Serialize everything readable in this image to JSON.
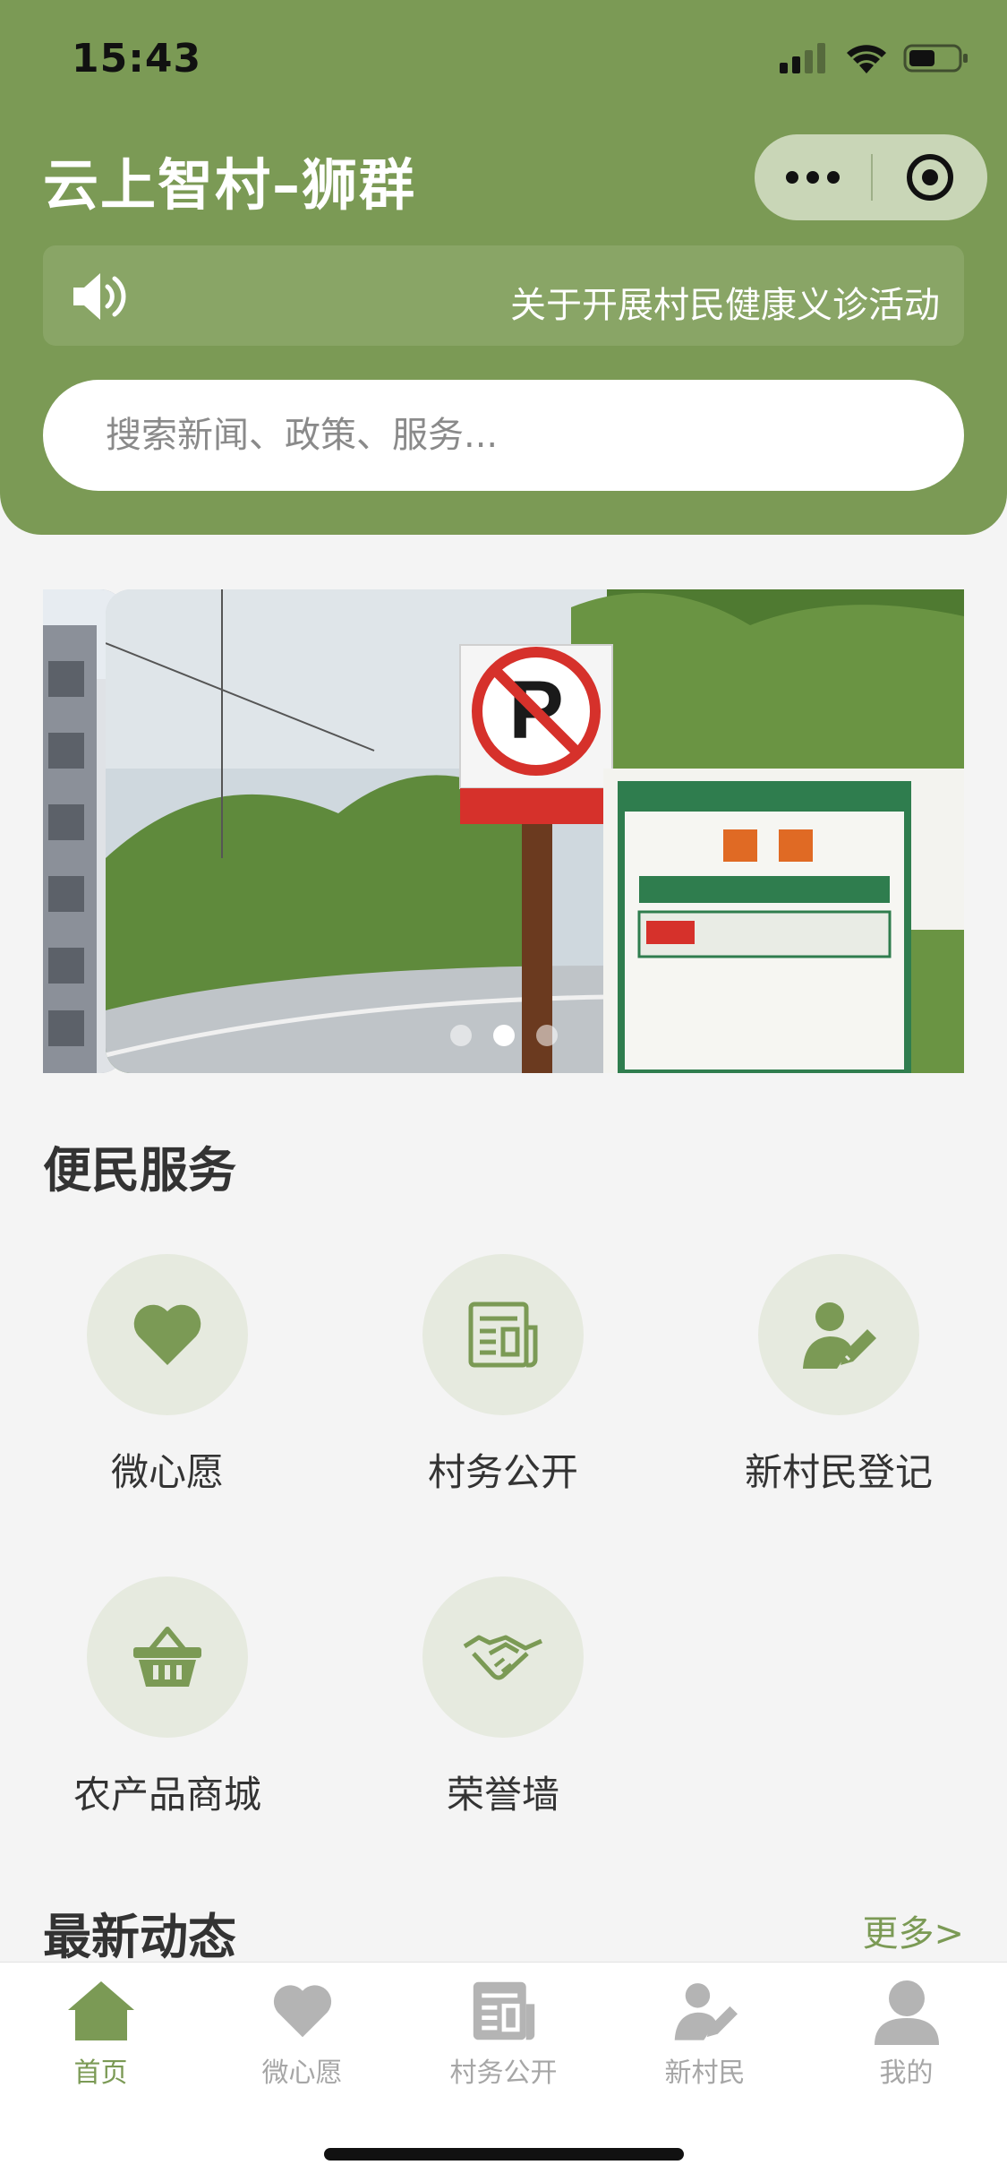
{
  "status_bar": {
    "time": "15:43"
  },
  "header": {
    "title": "云上智村–狮群",
    "notice": "关于开展村民健康义诊活动",
    "search_placeholder": "搜索新闻、政策、服务..."
  },
  "carousel": {
    "slide_count": 3,
    "active_index": 1
  },
  "services": {
    "title": "便民服务",
    "items": [
      {
        "label": "微心愿",
        "icon": "heart-icon"
      },
      {
        "label": "村务公开",
        "icon": "newspaper-icon"
      },
      {
        "label": "新村民登记",
        "icon": "user-edit-icon"
      },
      {
        "label": "农产品商城",
        "icon": "basket-icon"
      },
      {
        "label": "荣誉墙",
        "icon": "handshake-icon"
      }
    ]
  },
  "news": {
    "title": "最新动态",
    "more": "更多>"
  },
  "tabbar": {
    "items": [
      {
        "label": "首页",
        "icon": "home-icon",
        "active": true
      },
      {
        "label": "微心愿",
        "icon": "heart-icon",
        "active": false
      },
      {
        "label": "村务公开",
        "icon": "newspaper-icon",
        "active": false
      },
      {
        "label": "新村民",
        "icon": "user-edit-icon",
        "active": false
      },
      {
        "label": "我的",
        "icon": "user-icon",
        "active": false
      }
    ]
  },
  "colors": {
    "brand": "#7b9a55",
    "tab_inactive": "#a6a6a6",
    "service_circle": "#e6eadf"
  }
}
